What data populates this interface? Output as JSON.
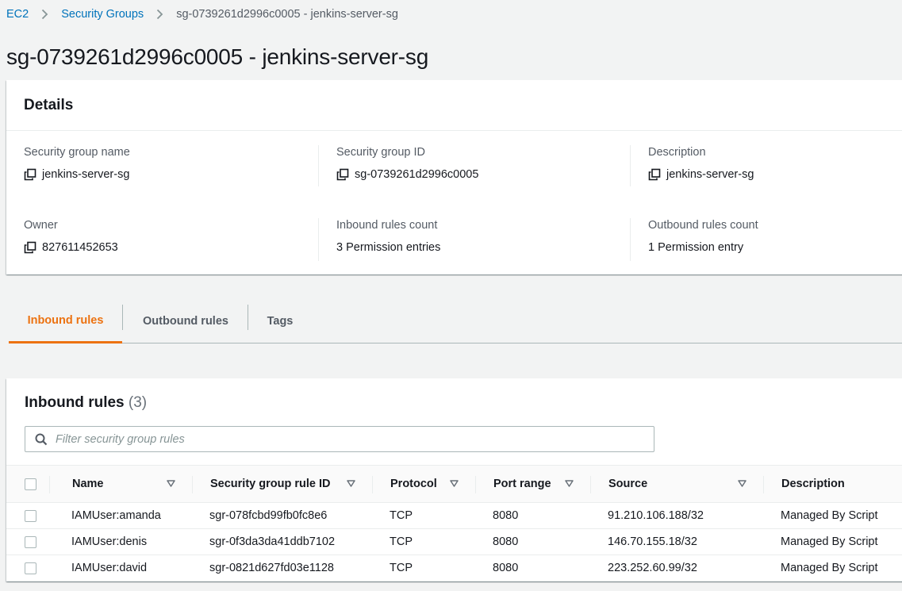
{
  "breadcrumb": {
    "items": [
      "EC2",
      "Security Groups"
    ],
    "current": "sg-0739261d2996c0005 - jenkins-server-sg"
  },
  "page": {
    "title": "sg-0739261d2996c0005 - jenkins-server-sg"
  },
  "details": {
    "header": "Details",
    "sg_name_label": "Security group name",
    "sg_name_value": "jenkins-server-sg",
    "sg_id_label": "Security group ID",
    "sg_id_value": "sg-0739261d2996c0005",
    "description_label": "Description",
    "description_value": "jenkins-server-sg",
    "owner_label": "Owner",
    "owner_value": "827611452653",
    "inbound_count_label": "Inbound rules count",
    "inbound_count_value": "3 Permission entries",
    "outbound_count_label": "Outbound rules count",
    "outbound_count_value": "1 Permission entry"
  },
  "tabs": [
    {
      "label": "Inbound rules",
      "active": true
    },
    {
      "label": "Outbound rules",
      "active": false
    },
    {
      "label": "Tags",
      "active": false
    }
  ],
  "inbound": {
    "title": "Inbound rules",
    "count": "(3)",
    "filter_placeholder": "Filter security group rules",
    "columns": [
      "Name",
      "Security group rule ID",
      "Protocol",
      "Port range",
      "Source",
      "Description"
    ],
    "rows": [
      {
        "name": "IAMUser:amanda",
        "rule_id": "sgr-078fcbd99fb0fc8e6",
        "protocol": "TCP",
        "port": "8080",
        "source": "91.210.106.188/32",
        "description": "Managed By Script"
      },
      {
        "name": "IAMUser:denis",
        "rule_id": "sgr-0f3da3da41ddb7102",
        "protocol": "TCP",
        "port": "8080",
        "source": "146.70.155.18/32",
        "description": "Managed By Script"
      },
      {
        "name": "IAMUser:david",
        "rule_id": "sgr-0821d627fd03e1128",
        "protocol": "TCP",
        "port": "8080",
        "source": "223.252.60.99/32",
        "description": "Managed By Script"
      }
    ]
  },
  "colors": {
    "link": "#0073bb",
    "active_tab": "#ec7211",
    "text": "#16191f",
    "muted": "#545b64"
  }
}
